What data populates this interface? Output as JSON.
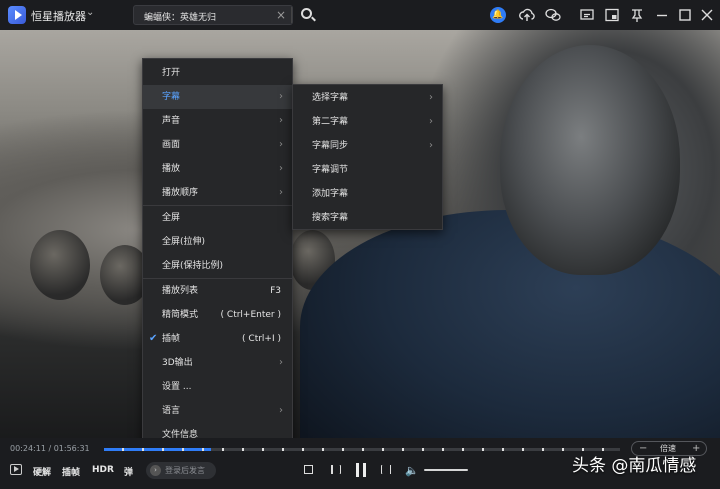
{
  "app": {
    "title": "恒星播放器",
    "search_query": "蝙蝠侠：英雄无归"
  },
  "main_menu": {
    "items": [
      {
        "label": "打开",
        "has_submenu": false,
        "shortcut": "",
        "checked": false
      },
      {
        "label": "字幕",
        "has_submenu": true,
        "shortcut": "",
        "checked": false,
        "active": true
      },
      {
        "label": "声音",
        "has_submenu": true,
        "shortcut": "",
        "checked": false
      },
      {
        "label": "画面",
        "has_submenu": true,
        "shortcut": "",
        "checked": false
      },
      {
        "label": "播放",
        "has_submenu": true,
        "shortcut": "",
        "checked": false
      },
      {
        "label": "播放顺序",
        "has_submenu": true,
        "shortcut": "",
        "checked": false
      },
      {
        "label": "全屏",
        "has_submenu": false,
        "shortcut": "",
        "checked": false
      },
      {
        "label": "全屏(拉伸)",
        "has_submenu": false,
        "shortcut": "",
        "checked": false
      },
      {
        "label": "全屏(保持比例)",
        "has_submenu": false,
        "shortcut": "",
        "checked": false
      },
      {
        "label": "播放列表",
        "has_submenu": false,
        "shortcut": "F3",
        "checked": false
      },
      {
        "label": "精简模式",
        "has_submenu": false,
        "shortcut": "( Ctrl+Enter )",
        "checked": false
      },
      {
        "label": "插帧",
        "has_submenu": false,
        "shortcut": "( Ctrl+I )",
        "checked": true
      },
      {
        "label": "3D输出",
        "has_submenu": true,
        "shortcut": "",
        "checked": false
      },
      {
        "label": "设置 ...",
        "has_submenu": false,
        "shortcut": "",
        "checked": false
      },
      {
        "label": "语言",
        "has_submenu": true,
        "shortcut": "",
        "checked": false
      },
      {
        "label": "文件信息",
        "has_submenu": false,
        "shortcut": "",
        "checked": false
      }
    ]
  },
  "subtitle_submenu": {
    "items": [
      {
        "label": "选择字幕",
        "has_submenu": true
      },
      {
        "label": "第二字幕",
        "has_submenu": true
      },
      {
        "label": "字幕同步",
        "has_submenu": true
      },
      {
        "label": "字幕调节",
        "has_submenu": false
      },
      {
        "label": "添加字幕",
        "has_submenu": false
      },
      {
        "label": "搜索字幕",
        "has_submenu": false
      }
    ]
  },
  "controls": {
    "time": "00:24:11 / 01:56:31",
    "progress_fraction": 0.207,
    "speed_label": "倍速",
    "hw_decode_label": "硬解",
    "frame_interp_label": "插帧",
    "hdr_label": "HDR",
    "danmu_label": "弹",
    "danmu_placeholder": "登录后发言"
  },
  "watermark": "头条 @南瓜情感",
  "colors": {
    "accent": "#2f7cf6",
    "menu_bg": "#262729",
    "active_text": "#5aa3ff"
  }
}
